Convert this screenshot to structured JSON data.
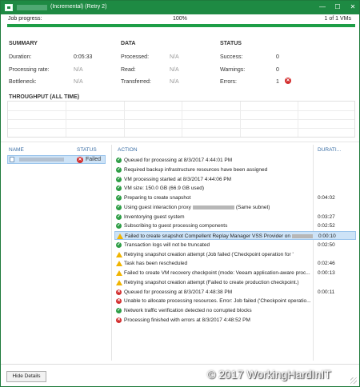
{
  "window": {
    "title": "(Incremental) (Retry 2)",
    "min_symbol": "—",
    "max_symbol": "☐",
    "close_symbol": "✕"
  },
  "progress": {
    "label": "Job progress:",
    "percent_text": "100%",
    "percent_value": 100,
    "count_text": "1 of 1 VMs"
  },
  "summary": {
    "header": "SUMMARY",
    "rows": [
      {
        "label": "Duration:",
        "value": "0:05:33"
      },
      {
        "label": "Processing rate:",
        "value": "N/A"
      },
      {
        "label": "Bottleneck:",
        "value": "N/A"
      }
    ]
  },
  "data": {
    "header": "DATA",
    "rows": [
      {
        "label": "Processed:",
        "value": "N/A"
      },
      {
        "label": "Read:",
        "value": "N/A"
      },
      {
        "label": "Transferred:",
        "value": "N/A"
      }
    ]
  },
  "status": {
    "header": "STATUS",
    "rows": [
      {
        "label": "Success:",
        "value": "0"
      },
      {
        "label": "Warnings:",
        "value": "0"
      },
      {
        "label": "Errors:",
        "value": "1"
      }
    ]
  },
  "throughput": {
    "title": "THROUGHPUT (ALL TIME)"
  },
  "vm_list": {
    "col_name": "NAME",
    "col_status": "STATUS",
    "vm_status": "Failed"
  },
  "actions": {
    "col_action": "ACTION",
    "col_duration": "DURATI...",
    "rows": [
      {
        "icon": "ok",
        "text": "Queued for processing at 8/3/2017 4:44:01 PM",
        "dur": ""
      },
      {
        "icon": "ok",
        "text": "Required backup infrastructure resources have been assigned",
        "dur": ""
      },
      {
        "icon": "ok",
        "text": "VM processing started at 8/3/2017 4:44:06 PM",
        "dur": ""
      },
      {
        "icon": "ok",
        "text": "VM size: 150.0 GB (66.9 GB used)",
        "dur": ""
      },
      {
        "icon": "ok",
        "text": "Preparing to create snapshot",
        "dur": "0:04:02"
      },
      {
        "icon": "ok",
        "text": "Using guest interaction proxy",
        "suffix": "(Same subnet)",
        "dur": ""
      },
      {
        "icon": "ok",
        "text": "Inventorying guest system",
        "dur": "0:03:27"
      },
      {
        "icon": "ok",
        "text": "Subscribing to guest processing components",
        "dur": "0:02:52"
      },
      {
        "icon": "warn",
        "text": "Failed to create snapshot Compellent Replay Manager VSS Provider on",
        "dur": "0:00:10",
        "selected": true
      },
      {
        "icon": "ok",
        "text": "Transaction logs will not be truncated",
        "dur": "0:02:50"
      },
      {
        "icon": "warn",
        "text": "Retrying snapshot creation attempt (Job failed ('Checkpoint operation for '",
        "dur": ""
      },
      {
        "icon": "warn",
        "text": "Task has been rescheduled",
        "dur": "0:02:46"
      },
      {
        "icon": "warn",
        "text": "Failed to create VM recovery checkpoint (mode: Veeam application-aware proc...",
        "dur": "0:00:13"
      },
      {
        "icon": "warn",
        "text": "Retrying snapshot creation attempt (Failed to create production checkpoint.)",
        "dur": ""
      },
      {
        "icon": "err",
        "text": "Queued for processing at 8/3/2017 4:48:38 PM",
        "dur": "0:00:11"
      },
      {
        "icon": "err",
        "text": "Unable to allocate processing resources. Error: Job failed ('Checkpoint operatio...",
        "dur": ""
      },
      {
        "icon": "ok",
        "text": "Network traffic verification detected no corrupted blocks",
        "dur": ""
      },
      {
        "icon": "err",
        "text": "Processing finished with errors at 8/3/2017 4:48:52 PM",
        "dur": ""
      }
    ]
  },
  "footer": {
    "hide_details": "Hide Details",
    "watermark": "© 2017 WorkingHardInIT"
  },
  "colors": {
    "title_bar": "#1e8a43",
    "progress": "#1e9e47",
    "success": "#2e9e46",
    "warning": "#f0b400",
    "error": "#d32f2f",
    "selection": "#cde3f7"
  }
}
